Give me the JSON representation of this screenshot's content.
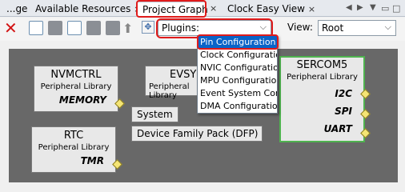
{
  "tabs": [
    {
      "label": "...ge"
    },
    {
      "label": "Available Resources",
      "close": "×"
    },
    {
      "label": "Project Graph",
      "close": "×"
    },
    {
      "label": "Clock Easy View",
      "close": "×"
    }
  ],
  "toolbar": {
    "plugins_label": "Plugins:",
    "view_label": "View:",
    "view_value": "Root"
  },
  "plugins_menu": [
    "Pin Configuration",
    "Clock Configuration",
    "NVIC Configuration",
    "MPU Configuration",
    "Event System Configuration",
    "DMA Configuration"
  ],
  "graph": {
    "nvmctrl": {
      "name": "NVMCTRL",
      "sub": "Peripheral Library",
      "port": "MEMORY"
    },
    "evsys": {
      "name": "EVSYS",
      "sub": "Peripheral Library"
    },
    "sercom5": {
      "name": "SERCOM5",
      "sub": "Peripheral Library",
      "ports": [
        "I2C",
        "SPI",
        "UART"
      ]
    },
    "rtc": {
      "name": "RTC",
      "sub": "Peripheral Library",
      "port": "TMR"
    },
    "system": "System",
    "dfp": "Device Family Pack (DFP)"
  }
}
